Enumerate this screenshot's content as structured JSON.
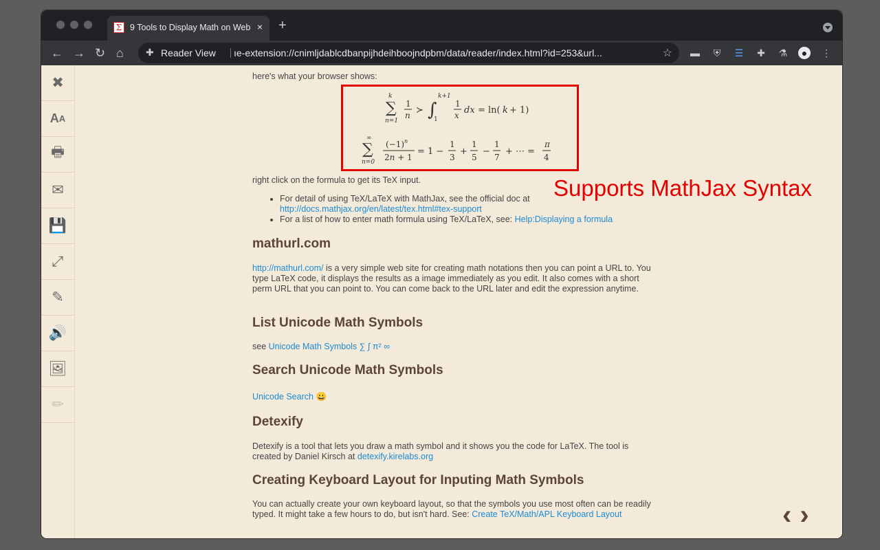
{
  "browser": {
    "tab_title": "9 Tools to Display Math on Web",
    "tab_close": "×",
    "new_tab": "+",
    "omnibox_label": "Reader View",
    "url": "ıe-extension://cnimljdablcdbanpijhdeihboojndpbm/data/reader/index.html?id=253&url..."
  },
  "sidebar": {
    "items": [
      {
        "icon": "close-icon",
        "glyph": "✖"
      },
      {
        "icon": "font-size-icon",
        "glyph": "AA"
      },
      {
        "icon": "print-icon",
        "glyph": "🖶"
      },
      {
        "icon": "email-icon",
        "glyph": "✉"
      },
      {
        "icon": "save-icon",
        "glyph": "💾"
      },
      {
        "icon": "fullscreen-icon",
        "glyph": "⤢"
      },
      {
        "icon": "edit-icon",
        "glyph": "✎"
      },
      {
        "icon": "speaker-icon",
        "glyph": "🔊"
      },
      {
        "icon": "image-icon",
        "glyph": "🖼"
      },
      {
        "icon": "pencil-icon",
        "glyph": "✏"
      }
    ]
  },
  "article": {
    "intro": "here's what your browser shows:",
    "after_math": "right click on the formula to get its TeX input.",
    "bullet1_text": "For detail of using TeX/LaTeX with MathJax, see the official doc at",
    "bullet1_link": "http://docs.mathjax.org/en/latest/tex.html#tex-support",
    "bullet2_text": "For a list of how to enter math formula using TeX/LaTeX, see: ",
    "bullet2_link": "Help:Displaying a formula",
    "h_mathurl": "mathurl.com",
    "mathurl_link": "http://mathurl.com/",
    "mathurl_text": " is a very simple web site for creating math notations then you can point a URL to. You type LaTeX code, it displays the results as a image immediately as you edit. It also comes with a short perm URL that you can point to. You can come back to the URL later and edit the expression anytime.",
    "h_list": "List Unicode Math Symbols",
    "list_text": "see ",
    "list_link": "Unicode Math Symbols ∑ ∫ π² ∞",
    "h_search": "Search Unicode Math Symbols",
    "search_link": "Unicode Search",
    "search_emoji": "😀",
    "h_detexify": "Detexify",
    "detexify_text": "Detexify is a tool that lets you draw a math symbol and it shows you the code for LaTeX. The tool is created by Daniel Kirsch at ",
    "detexify_link": "detexify.kirelabs.org",
    "h_keyboard": "Creating Keyboard Layout for Inputing Math Symbols",
    "keyboard_text": "You can actually create your own keyboard layout, so that the symbols you use most often can be readily typed. It might take a few hours to do, but isn't hard. See: ",
    "keyboard_link": "Create TeX/Math/APL Keyboard Layout"
  },
  "annotation": "Supports MathJax Syntax",
  "pager": {
    "prev": "‹",
    "next": "›"
  }
}
